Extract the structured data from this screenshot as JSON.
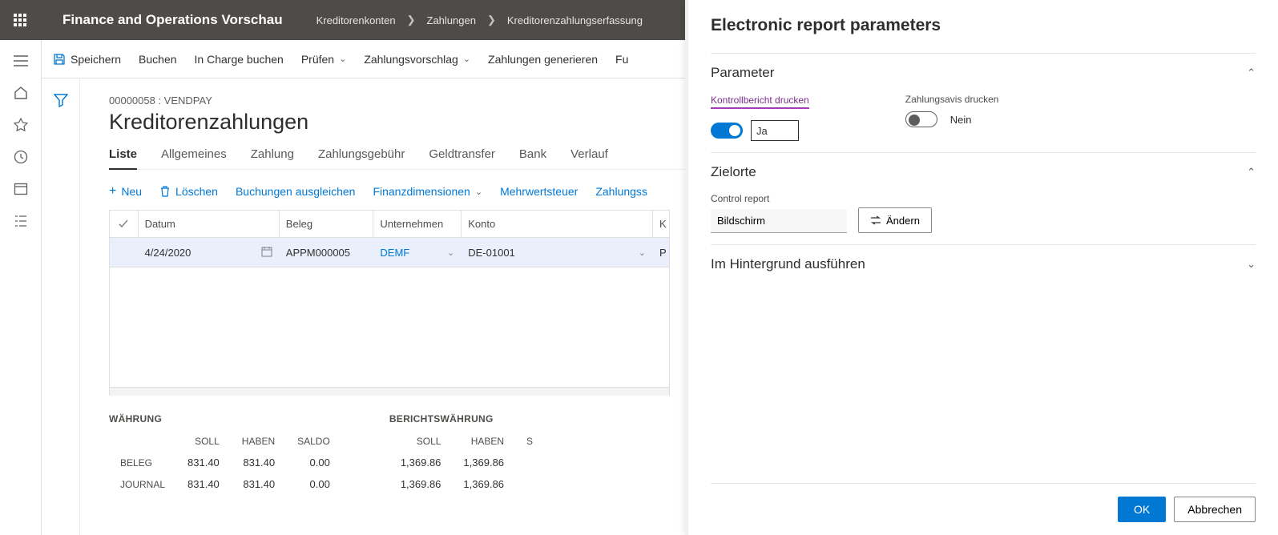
{
  "header": {
    "app_title": "Finance and Operations Vorschau",
    "breadcrumb": [
      "Kreditorenkonten",
      "Zahlungen",
      "Kreditorenzahlungserfassung"
    ]
  },
  "commands": {
    "save": "Speichern",
    "post": "Buchen",
    "post_charge": "In Charge buchen",
    "validate": "Prüfen",
    "proposal": "Zahlungsvorschlag",
    "generate": "Zahlungen generieren",
    "fu": "Fu"
  },
  "page": {
    "caption": "00000058 : VENDPAY",
    "title": "Kreditorenzahlungen",
    "tabs": [
      "Liste",
      "Allgemeines",
      "Zahlung",
      "Zahlungsgebühr",
      "Geldtransfer",
      "Bank",
      "Verlauf"
    ],
    "active_tab": 0
  },
  "grid_toolbar": {
    "new": "Neu",
    "delete": "Löschen",
    "settle": "Buchungen ausgleichen",
    "findim": "Finanzdimensionen",
    "vat": "Mehrwertsteuer",
    "paymentstatus": "Zahlungss"
  },
  "grid": {
    "columns": {
      "date": "Datum",
      "voucher": "Beleg",
      "company": "Unternehmen",
      "account": "Konto",
      "last": "K"
    },
    "rows": [
      {
        "date": "4/24/2020",
        "voucher": "APPM000005",
        "company": "DEMF",
        "account": "DE-01001",
        "last": "P"
      }
    ]
  },
  "totals": {
    "currency_label": "WÄHRUNG",
    "report_currency_label": "BERICHTSWÄHRUNG",
    "cols": [
      "SOLL",
      "HABEN",
      "SALDO"
    ],
    "cols_report": [
      "SOLL",
      "HABEN"
    ],
    "cols_report_last": "S",
    "rows": [
      {
        "label": "BELEG",
        "soll": "831.40",
        "haben": "831.40",
        "saldo": "0.00",
        "rsoll": "1,369.86",
        "rhaben": "1,369.86"
      },
      {
        "label": "JOURNAL",
        "soll": "831.40",
        "haben": "831.40",
        "saldo": "0.00",
        "rsoll": "1,369.86",
        "rhaben": "1,369.86"
      }
    ]
  },
  "panel": {
    "title": "Electronic report parameters",
    "section_parameter": "Parameter",
    "print_control_label": "Kontrollbericht drucken",
    "print_control_value": "Ja",
    "print_advice_label": "Zahlungsavis drucken",
    "print_advice_value": "Nein",
    "section_dest": "Zielorte",
    "control_report_label": "Control report",
    "control_report_value": "Bildschirm",
    "change_btn": "Ändern",
    "section_background": "Im Hintergrund ausführen",
    "ok": "OK",
    "cancel": "Abbrechen"
  }
}
